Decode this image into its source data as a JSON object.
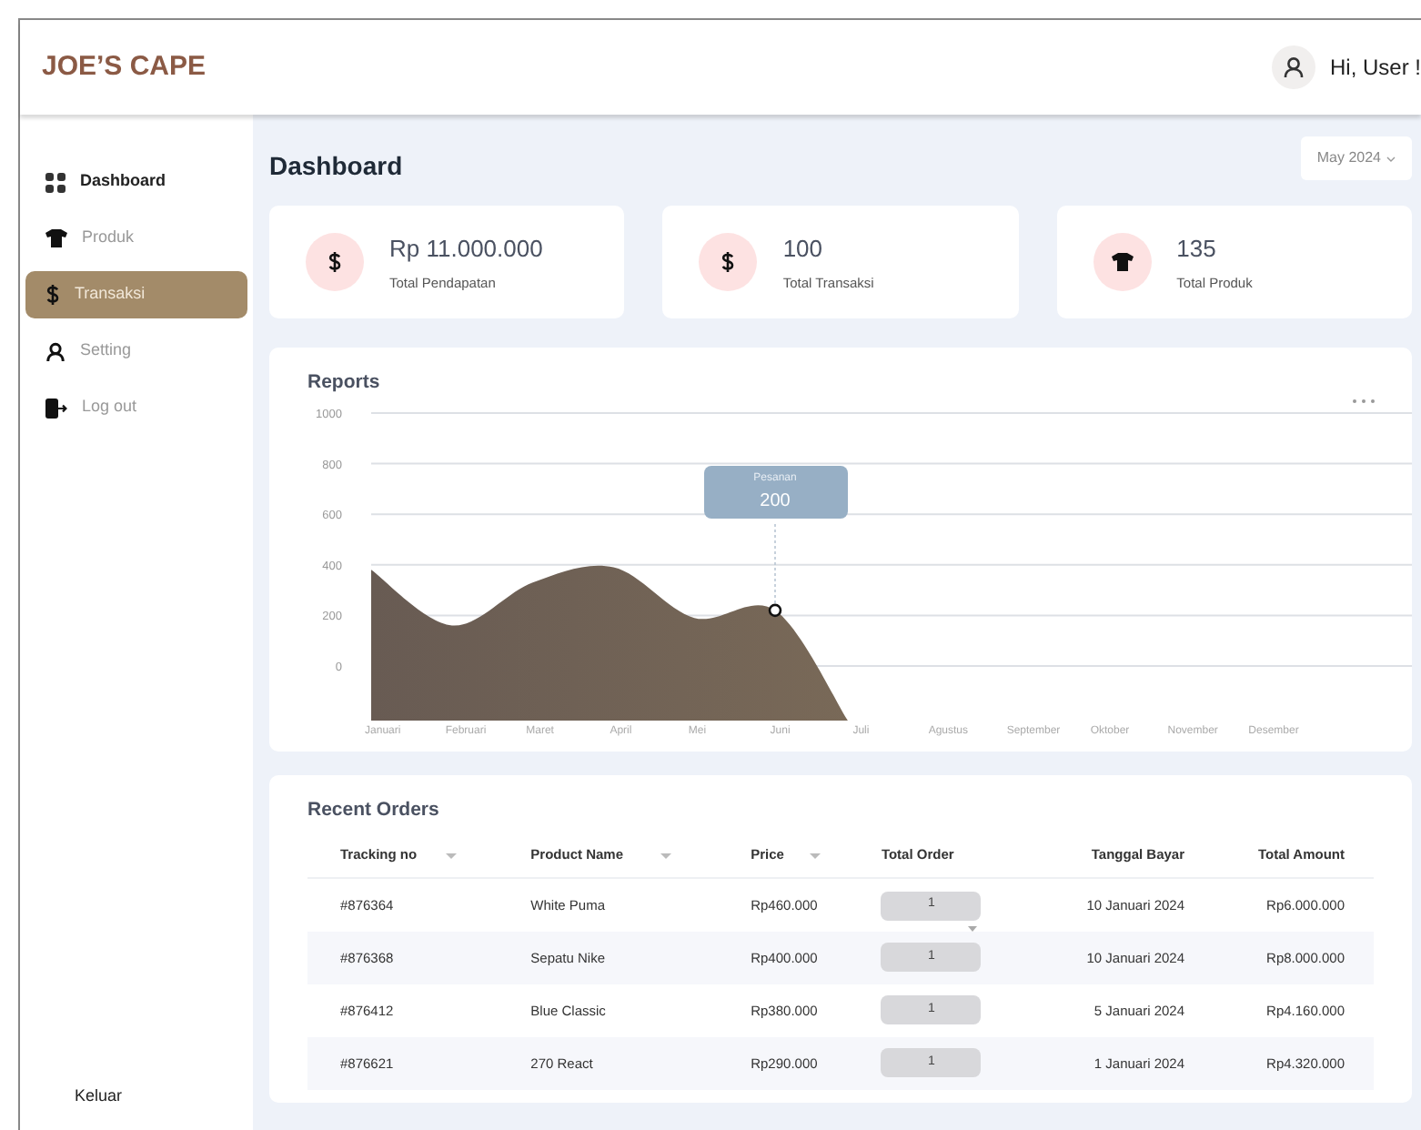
{
  "brand": "JOE’S CAPE",
  "user": {
    "greeting": "Hi, User !"
  },
  "sidebar": {
    "items": [
      {
        "label": "Dashboard",
        "bold": true,
        "selected": false
      },
      {
        "label": "Produk",
        "bold": false,
        "selected": false
      },
      {
        "label": "Transaksi",
        "bold": false,
        "selected": true
      },
      {
        "label": "Setting",
        "bold": false,
        "selected": false
      },
      {
        "label": "Log out",
        "bold": false,
        "selected": false
      }
    ],
    "footer": "Keluar"
  },
  "page_title": "Dashboard",
  "period": "May 2024",
  "stats": [
    {
      "value": "Rp 11.000.000",
      "label": "Total Pendapatan"
    },
    {
      "value": "100",
      "label": "Total Transaksi"
    },
    {
      "value": "135",
      "label": "Total Produk"
    }
  ],
  "reports": {
    "title": "Reports",
    "tooltip": {
      "value": "200"
    },
    "chart_data": {
      "type": "area",
      "categories": [
        "Januari",
        "Februari",
        "Maret",
        "April",
        "Mei",
        "Juni",
        "Juli",
        "Agustus",
        "September",
        "Oktober",
        "November",
        "Desember"
      ],
      "series": [
        {
          "name": "Pesanan",
          "color": "#7a6a58",
          "values": [
            380,
            160,
            330,
            390,
            190,
            220,
            null,
            null,
            null,
            null,
            null,
            null
          ]
        }
      ],
      "ylim": [
        0,
        1000
      ],
      "yticks": [
        0,
        200,
        400,
        600,
        800,
        1000
      ],
      "grid": true
    }
  },
  "orders": {
    "title": "Recent Orders",
    "columns": [
      {
        "label": "Tracking no",
        "sortable": true
      },
      {
        "label": "Product Name",
        "sortable": true
      },
      {
        "label": "Price",
        "sortable": true
      },
      {
        "label": "Total Order",
        "sortable": false
      },
      {
        "label": "Tanggal Bayar",
        "sortable": false
      },
      {
        "label": "Total Amount",
        "sortable": false
      }
    ],
    "rows": [
      {
        "tracking": "#876364",
        "product": "White Puma",
        "price": "Rp460.000",
        "total_order": "1",
        "date": "10 Januari 2024",
        "amount": "Rp6.000.000",
        "dropdown": true
      },
      {
        "tracking": "#876368",
        "product": "Sepatu Nike",
        "price": "Rp400.000",
        "total_order": "1",
        "date": "10 Januari 2024",
        "amount": "Rp8.000.000",
        "dropdown": false
      },
      {
        "tracking": "#876412",
        "product": "Blue Classic",
        "price": "Rp380.000",
        "total_order": "1",
        "date": "5 Januari 2024",
        "amount": "Rp4.160.000",
        "dropdown": false
      },
      {
        "tracking": "#876621",
        "product": "270 React",
        "price": "Rp290.000",
        "total_order": "1",
        "date": "1 Januari 2024",
        "amount": "Rp4.320.000",
        "dropdown": false
      }
    ]
  }
}
